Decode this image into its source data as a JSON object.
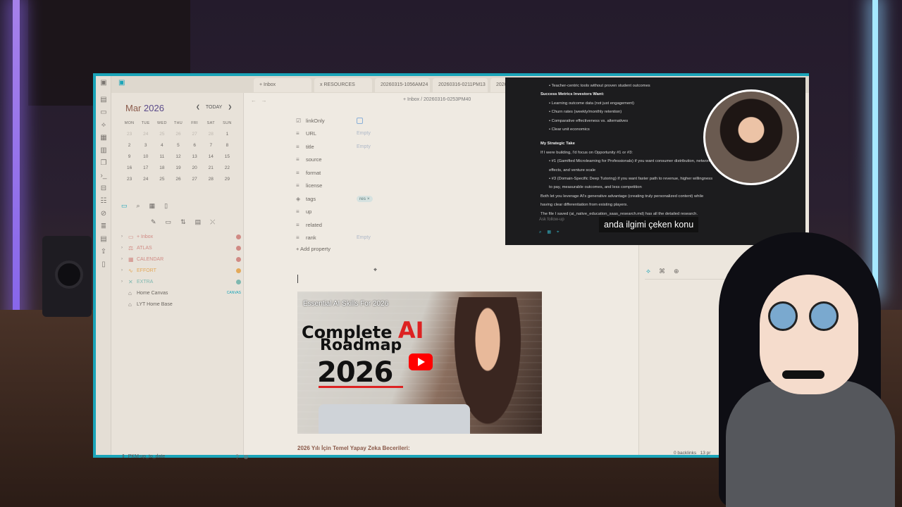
{
  "tabs": [
    {
      "label": "+ Inbox"
    },
    {
      "label": "x RESOURCES"
    },
    {
      "label": "20260315-1056AM24"
    },
    {
      "label": "20260316-0211PM13"
    },
    {
      "label": "2026"
    }
  ],
  "calendar": {
    "month": "Mar",
    "year": "2026",
    "today_label": "TODAY",
    "weekdays": [
      "MON",
      "TUE",
      "WED",
      "THU",
      "FRI",
      "SAT",
      "SUN"
    ],
    "days": [
      [
        "23",
        "24",
        "25",
        "26",
        "27",
        "28",
        "1"
      ],
      [
        "2",
        "3",
        "4",
        "5",
        "6",
        "7",
        "8"
      ],
      [
        "9",
        "10",
        "11",
        "12",
        "13",
        "14",
        "15"
      ],
      [
        "16",
        "17",
        "18",
        "19",
        "20",
        "21",
        "22"
      ],
      [
        "23",
        "24",
        "25",
        "26",
        "27",
        "28",
        "29"
      ]
    ]
  },
  "tree": [
    {
      "label": "+ Inbox",
      "color": "#d08a84"
    },
    {
      "label": "ATLAS",
      "color": "#d08a84"
    },
    {
      "label": "CALENDAR",
      "color": "#d08a84"
    },
    {
      "label": "EFFORT",
      "color": "#e3a95a"
    },
    {
      "label": "EXTRA",
      "color": "#7fb8b0"
    },
    {
      "label": "Home Canvas",
      "badge": "CANVAS"
    },
    {
      "label": "LYT Home Base"
    }
  ],
  "vault": "PKM-up_to_date",
  "breadcrumb": "+ Inbox / 20260316-0253PM40",
  "properties": [
    {
      "name": "linkOnly",
      "value": ""
    },
    {
      "name": "URL",
      "value": "Empty"
    },
    {
      "name": "title",
      "value": "Empty"
    },
    {
      "name": "source",
      "value": ""
    },
    {
      "name": "format",
      "value": ""
    },
    {
      "name": "license",
      "value": ""
    },
    {
      "name": "tags",
      "value": "res ×"
    },
    {
      "name": "up",
      "value": ""
    },
    {
      "name": "related",
      "value": ""
    },
    {
      "name": "rank",
      "value": "Empty"
    }
  ],
  "add_property": "Add property",
  "video": {
    "top_title": "Essential AI Skills For 2026",
    "line1": "Complete",
    "line1_ai": "AI",
    "line2": "Roadmap",
    "line3": "2026"
  },
  "subheading": "2026 Yılı İçin Temel Yapay Zeka Becerileri:",
  "backlinks": "0 backlinks",
  "backlinks_extra": "13 pr",
  "overlay": {
    "lines": [
      {
        "t": "Teacher-centric tools without proven student outcomes",
        "cls": "ind"
      },
      {
        "t": "Success Metrics Investors Want:",
        "cls": "b"
      },
      {
        "t": "Learning outcome data (not just engagement)",
        "cls": "ind"
      },
      {
        "t": "Churn rates (weekly/monthly retention)",
        "cls": "ind"
      },
      {
        "t": "Comparative effectiveness vs. alternatives",
        "cls": "ind"
      },
      {
        "t": "Clear unit economics",
        "cls": "ind"
      },
      {
        "t": "",
        "cls": "sp"
      },
      {
        "t": "My Strategic Take",
        "cls": "b"
      },
      {
        "t": "If I were building, I'd focus on Opportunity #1 or #3:",
        "cls": ""
      },
      {
        "t": "#1 (Gamified Microlearning for Professionals) if you want consumer distribution, network effects, and venture scale",
        "cls": "ind"
      },
      {
        "t": "#3 (Domain-Specific Deep Tutoring) if you want faster path to revenue, higher willingness to pay, measurable outcomes, and less competition",
        "cls": "ind"
      },
      {
        "t": "Both let you leverage AI's generative advantage (creating truly personalized content) while having clear differentiation from existing players.",
        "cls": ""
      },
      {
        "t": "The file I saved (ai_native_education_saas_research.md) has all the detailed research.",
        "cls": ""
      }
    ],
    "followup": "Ask follow-up",
    "caption": "anda ilgimi çeken konu"
  }
}
